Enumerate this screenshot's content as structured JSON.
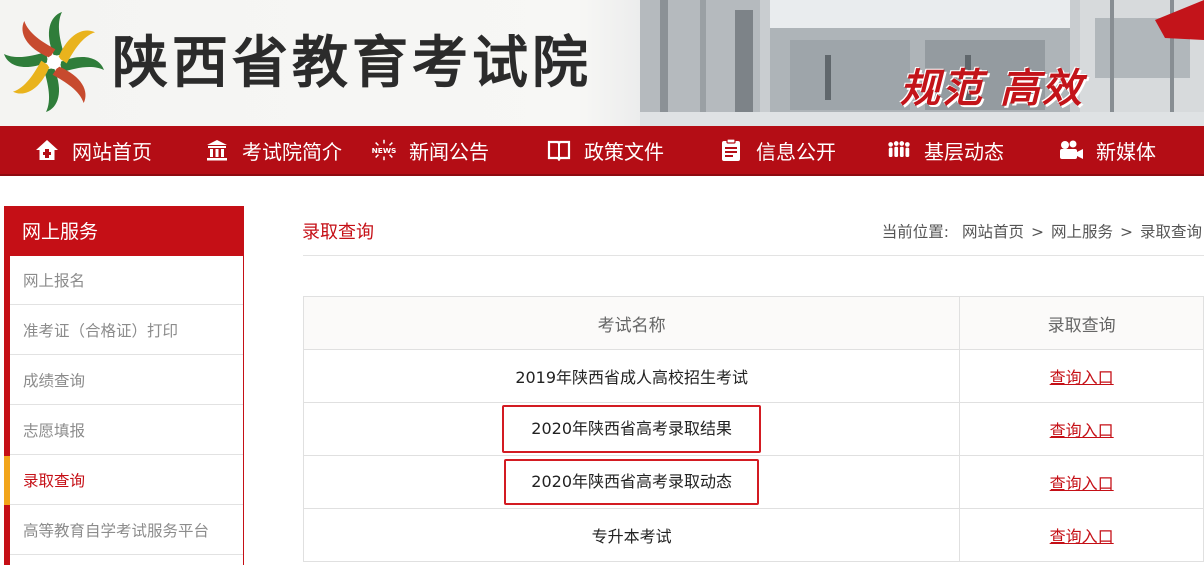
{
  "header": {
    "site_title": "陕西省教育考试院",
    "slogan": "规范 高效"
  },
  "nav": {
    "items": [
      {
        "label": "网站首页",
        "icon": "home-icon"
      },
      {
        "label": "考试院简介",
        "icon": "building-icon"
      },
      {
        "label": "新闻公告",
        "icon": "news-icon"
      },
      {
        "label": "政策文件",
        "icon": "book-icon"
      },
      {
        "label": "信息公开",
        "icon": "document-icon"
      },
      {
        "label": "基层动态",
        "icon": "people-icon"
      },
      {
        "label": "新媒体",
        "icon": "camera-icon"
      }
    ]
  },
  "sidebar": {
    "title": "网上服务",
    "items": [
      {
        "label": "网上报名"
      },
      {
        "label": "准考证（合格证）打印"
      },
      {
        "label": "成绩查询"
      },
      {
        "label": "志愿填报"
      },
      {
        "label": "录取查询",
        "active": true
      },
      {
        "label": "高等教育自学考试服务平台"
      }
    ]
  },
  "main": {
    "title": "录取查询",
    "breadcrumb": {
      "prefix": "当前位置:",
      "items": [
        "网站首页",
        "网上服务",
        "录取查询"
      ],
      "separator": ">"
    },
    "table": {
      "headers": [
        "考试名称",
        "录取查询"
      ],
      "rows": [
        {
          "name": "2019年陕西省成人高校招生考试",
          "link": "查询入口"
        },
        {
          "name": "2020年陕西省高考录取结果",
          "link": "查询入口",
          "highlighted": true
        },
        {
          "name": "2020年陕西省高考录取动态",
          "link": "查询入口",
          "highlighted": true
        },
        {
          "name": "专升本考试",
          "link": "查询入口"
        }
      ]
    }
  },
  "colors": {
    "brand_red": "#b40d15",
    "accent_red": "#c50f16",
    "active_marker": "#f2a51a",
    "highlight_box": "#d31b22"
  }
}
